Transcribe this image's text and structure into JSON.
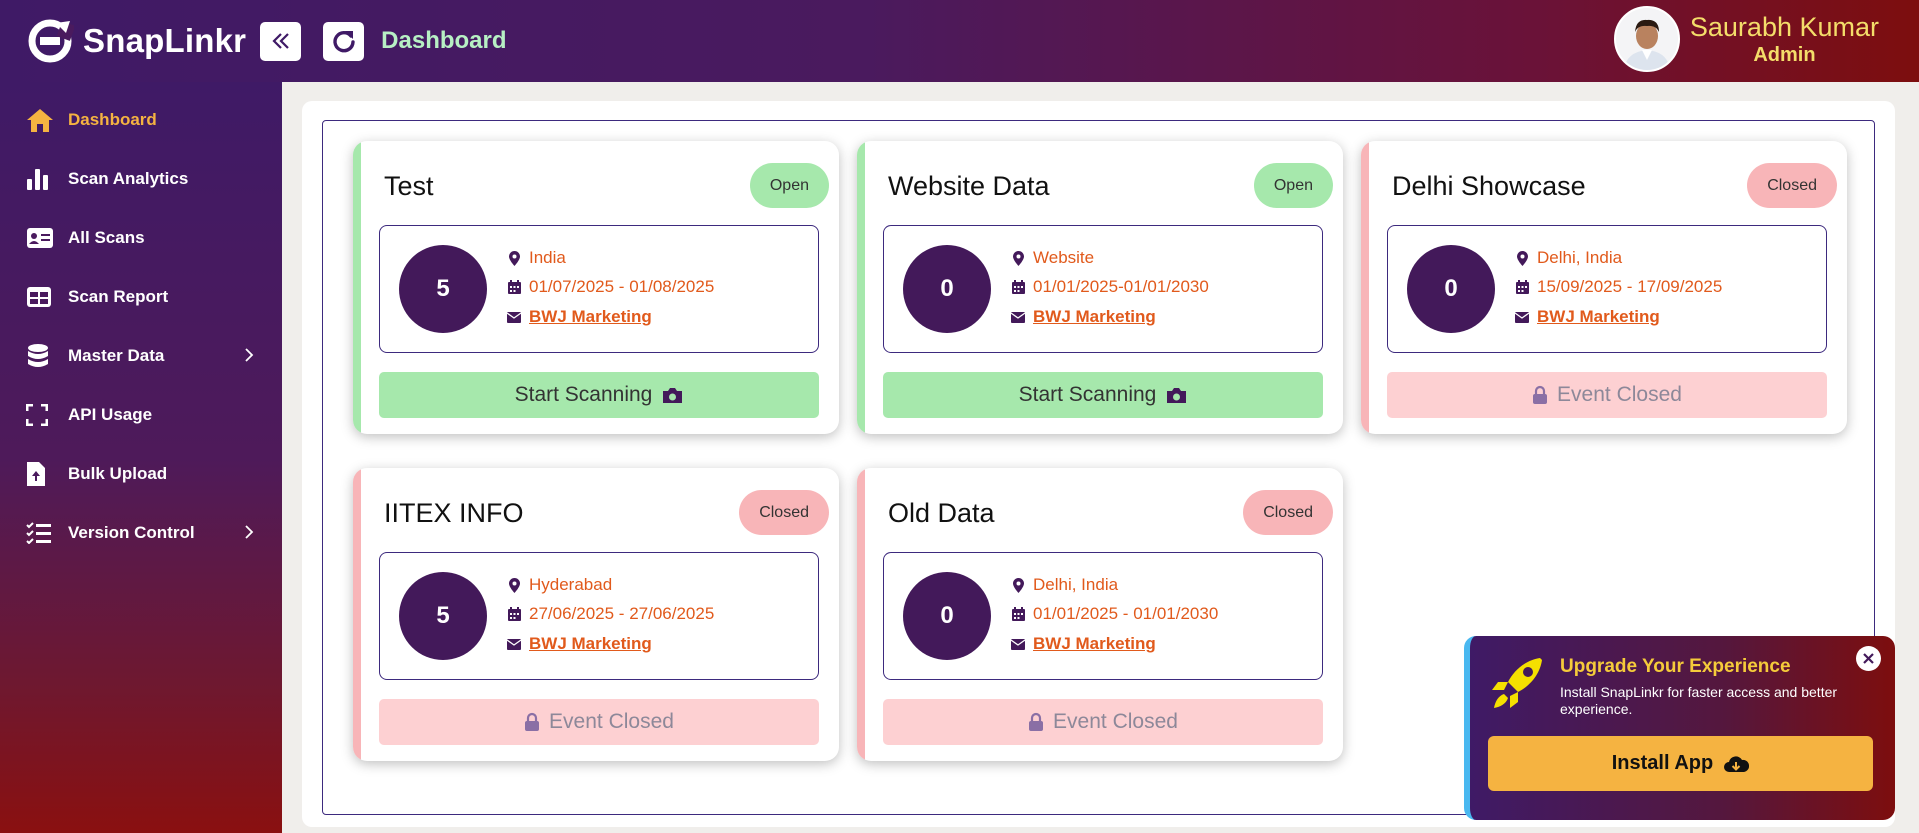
{
  "app": {
    "name": "SnapLinkr"
  },
  "header": {
    "page_title": "Dashboard"
  },
  "user": {
    "name": "Saurabh Kumar",
    "role": "Admin"
  },
  "sidebar": {
    "items": [
      {
        "label": "Dashboard",
        "icon": "home-icon",
        "active": true
      },
      {
        "label": "Scan Analytics",
        "icon": "bar-chart-icon"
      },
      {
        "label": "All Scans",
        "icon": "id-card-icon"
      },
      {
        "label": "Scan Report",
        "icon": "table-icon"
      },
      {
        "label": "Master Data",
        "icon": "database-icon",
        "expandable": true
      },
      {
        "label": "API Usage",
        "icon": "scan-frame-icon"
      },
      {
        "label": "Bulk Upload",
        "icon": "file-upload-icon"
      },
      {
        "label": "Version Control",
        "icon": "list-check-icon",
        "expandable": true
      }
    ]
  },
  "events": [
    {
      "title": "Test",
      "status": "Open",
      "count": "5",
      "location": "India",
      "dates": "01/07/2025 - 01/08/2025",
      "company": "BWJ Marketing",
      "action": "Start Scanning"
    },
    {
      "title": "Website Data",
      "status": "Open",
      "count": "0",
      "location": "Website",
      "dates": "01/01/2025-01/01/2030",
      "company": "BWJ Marketing",
      "action": "Start Scanning"
    },
    {
      "title": "Delhi Showcase",
      "status": "Closed",
      "count": "0",
      "location": "Delhi, India",
      "dates": "15/09/2025 - 17/09/2025",
      "company": "BWJ Marketing",
      "action": "Event Closed"
    },
    {
      "title": "IITEX INFO",
      "status": "Closed",
      "count": "5",
      "location": "Hyderabad",
      "dates": "27/06/2025 - 27/06/2025",
      "company": "BWJ Marketing",
      "action": "Event Closed"
    },
    {
      "title": "Old Data",
      "status": "Closed",
      "count": "0",
      "location": "Delhi, India",
      "dates": "01/01/2025 - 01/01/2030",
      "company": "BWJ Marketing",
      "action": "Event Closed"
    }
  ],
  "toast": {
    "title": "Upgrade Your Experience",
    "description": "Install SnapLinkr for faster access and better experience.",
    "button": "Install App"
  },
  "colors": {
    "brand_purple": "#43195a",
    "accent_orange": "#e15a1c",
    "open_green": "#a6e8ac",
    "closed_pink": "#f8b5b8",
    "install_yellow": "#f5b341"
  }
}
